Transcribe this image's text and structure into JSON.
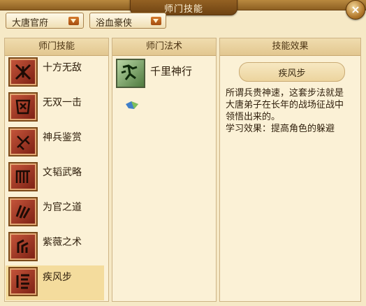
{
  "window": {
    "title": "师门技能",
    "close_label": "×"
  },
  "filters": {
    "sect": "大唐官府",
    "character": "浴血豪侠"
  },
  "panels": {
    "skills_header": "师门技能",
    "spells_header": "师门法术",
    "effect_header": "技能效果"
  },
  "skills": [
    {
      "label": "十方无敌",
      "icon": "crossed-blades-icon"
    },
    {
      "label": "无双一击",
      "icon": "armor-icon"
    },
    {
      "label": "神兵鉴赏",
      "icon": "weapon-icon"
    },
    {
      "label": "文韬武略",
      "icon": "scroll-icon"
    },
    {
      "label": "为官之道",
      "icon": "rank-icon"
    },
    {
      "label": "紫薇之术",
      "icon": "star-icon"
    },
    {
      "label": "疾风步",
      "icon": "wind-step-icon",
      "selected": true
    }
  ],
  "spells": [
    {
      "label": "千里神行",
      "icon": "running-man-icon"
    }
  ],
  "effect": {
    "name": "疾风步",
    "desc_line1": "所谓兵贵神速，这套步法就是",
    "desc_line2": "大唐弟子在长年的战场征战中",
    "desc_line3": "领悟出来的。",
    "desc_line4": "学习效果：提高角色的躲避"
  },
  "colors": {
    "accent": "#8d5f22",
    "skill_icon": "#a83a28",
    "selected_row": "#f4dc9d"
  }
}
